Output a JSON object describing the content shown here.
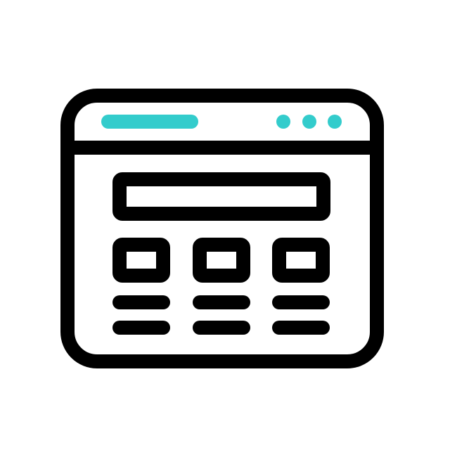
{
  "icon": {
    "name": "browser-window-layout-icon",
    "colors": {
      "stroke": "#000000",
      "accent": "#33cccc",
      "background": "#ffffff"
    }
  }
}
